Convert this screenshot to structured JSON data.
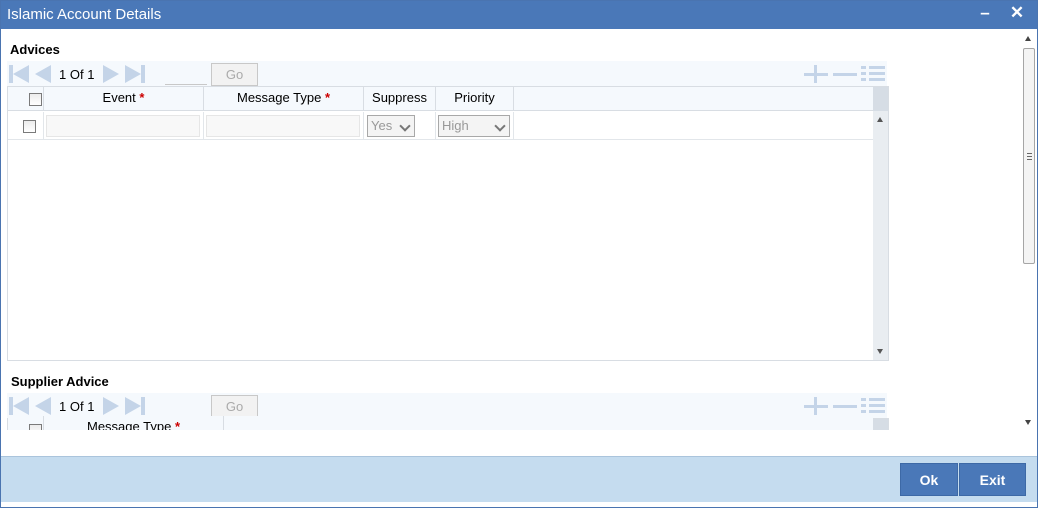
{
  "window": {
    "title": "Islamic Account Details",
    "minimize_glyph": "–",
    "close_glyph": "✕"
  },
  "advices": {
    "title": "Advices",
    "pager": {
      "current": "1",
      "of_label": "Of",
      "total": "1",
      "go_label": "Go"
    },
    "columns": {
      "event": "Event",
      "message_type": "Message Type",
      "suppress": "Suppress",
      "priority": "Priority",
      "required_mark": "*"
    },
    "rows": [
      {
        "event": "",
        "message_type": "",
        "suppress": "Yes",
        "priority": "High"
      }
    ]
  },
  "supplier_advice": {
    "title": "Supplier Advice",
    "pager": {
      "current": "1",
      "of_label": "Of",
      "total": "1",
      "go_label": "Go"
    },
    "columns": {
      "message_type": "Message Type",
      "required_mark": "*"
    }
  },
  "footer": {
    "ok_label": "Ok",
    "exit_label": "Exit"
  },
  "colors": {
    "titlebar": "#4a78b8",
    "footer": "#c5dcef",
    "button": "#4a78b8",
    "required": "#cc0000",
    "nav_icon": "#c4d4e8"
  }
}
